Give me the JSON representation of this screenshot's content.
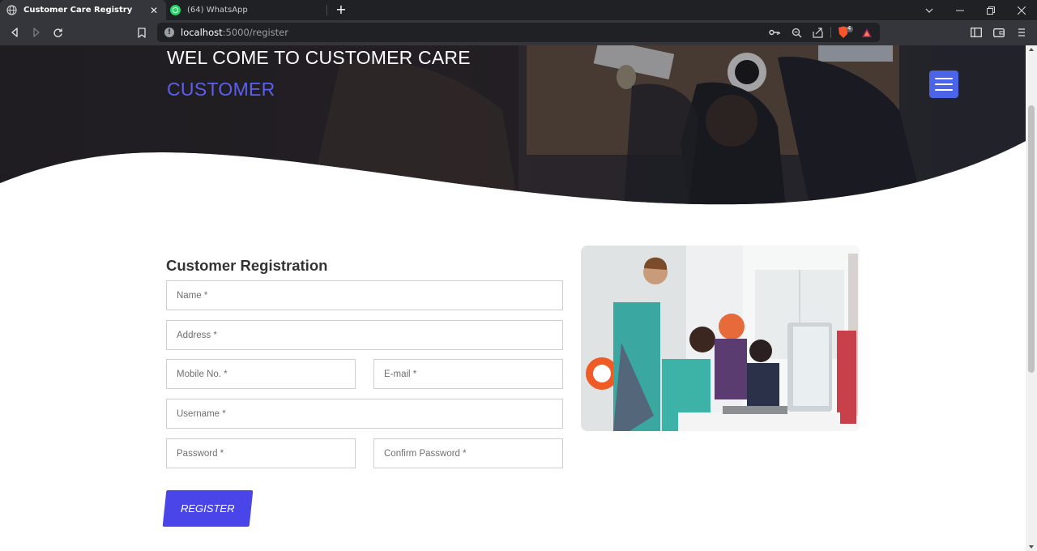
{
  "browser": {
    "tabs": [
      {
        "title": "Customer Care Registry",
        "active": true
      },
      {
        "title": "(64) WhatsApp",
        "active": false
      }
    ],
    "url_host": "localhost",
    "url_path": ":5000/register",
    "extension_badge": "4"
  },
  "hero": {
    "heading": "WEL COME TO CUSTOMER CARE",
    "subheading": "CUSTOMER"
  },
  "form": {
    "title": "Customer Registration",
    "fields": {
      "name": "Name *",
      "address": "Address *",
      "mobile": "Mobile No. *",
      "email": "E-mail *",
      "username": "Username *",
      "password": "Password *",
      "confirm_password": "Confirm Password *"
    },
    "submit_label": "REGISTER"
  },
  "colors": {
    "accent": "#4a45e8",
    "subheading": "#5b5ff0",
    "menu_button": "#4b64e8"
  }
}
